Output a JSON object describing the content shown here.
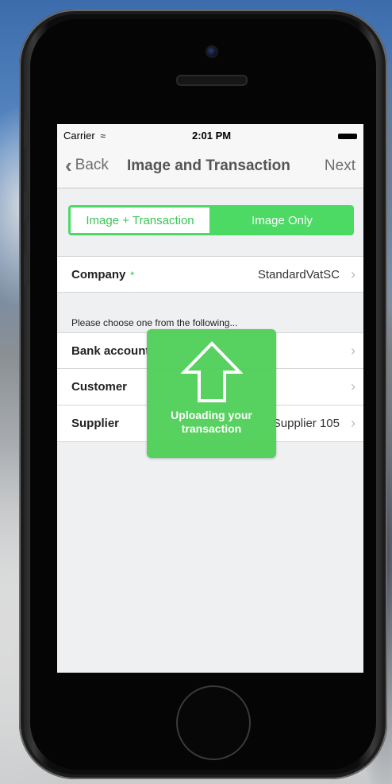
{
  "status_bar": {
    "carrier": "Carrier",
    "wifi_icon": "wifi-icon",
    "time": "2:01 PM"
  },
  "nav": {
    "back_label": "Back",
    "title": "Image and Transaction",
    "next_label": "Next"
  },
  "segmented": {
    "options": [
      "Image + Transaction",
      "Image Only"
    ],
    "selected": "Image Only"
  },
  "company": {
    "label": "Company",
    "required_marker": "*",
    "value": "StandardVatSC"
  },
  "hint": "Please choose one from the following...",
  "choices": [
    {
      "label": "Bank account",
      "value": ""
    },
    {
      "label": "Customer",
      "value": ""
    },
    {
      "label": "Supplier",
      "value": "Supplier 105"
    }
  ],
  "toast": {
    "message_line1": "Uploading your",
    "message_line2": "transaction",
    "icon": "upload-arrow-icon"
  },
  "colors": {
    "accent": "#4cd964",
    "toast": "#52d05a"
  }
}
